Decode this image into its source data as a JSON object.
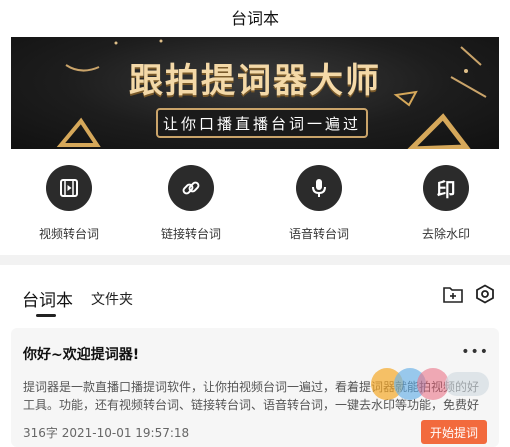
{
  "app": {
    "title": "台词本"
  },
  "banner": {
    "headline": "跟拍提词器大师",
    "subtitle": "让你口播直播台词一遍过"
  },
  "features": [
    {
      "label": "视频转台词",
      "icon": "film-icon"
    },
    {
      "label": "链接转台词",
      "icon": "link-icon"
    },
    {
      "label": "语音转台词",
      "icon": "microphone-icon"
    },
    {
      "label": "去除水印",
      "icon": "remove-watermark-icon",
      "glyph": "印"
    }
  ],
  "tabs": [
    {
      "label": "台词本",
      "active": true
    },
    {
      "label": "文件夹",
      "active": false
    }
  ],
  "toolbar": {
    "icons": [
      "new-folder-icon",
      "settings-hexagon-icon"
    ]
  },
  "script_card": {
    "title": "你好~欢迎提词器!",
    "more": "•••",
    "description": "提词器是一款直播口播提词软件，让你拍视频台词一遍过，看着提词器就能拍视频的好工具。功能，还有视频转台词、链接转台词、语音转台词，一键去水印等功能，免费好用的拍视频神器。",
    "word_count": "316字",
    "timestamp": "2021-10-01 19:57:18",
    "start_label": "开始提词"
  },
  "colors": {
    "accent": "#f26a3d",
    "icon_bg": "#2b2b2b",
    "gold": "#f4d9a8"
  }
}
